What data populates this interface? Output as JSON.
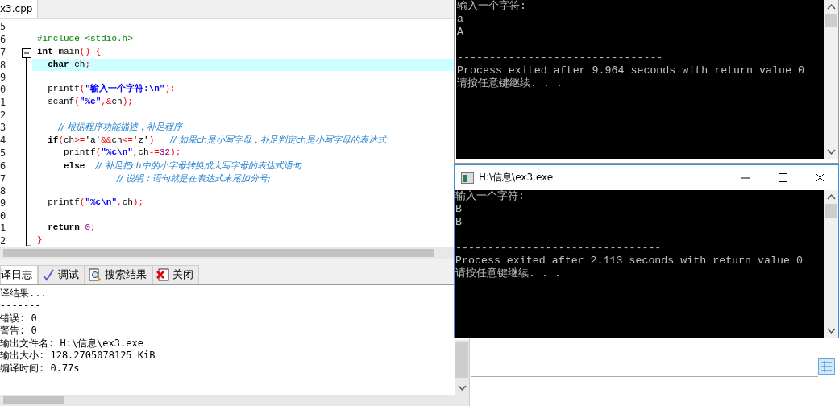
{
  "editor": {
    "tab_label": "x3.cpp",
    "lines": [
      {
        "number": "5",
        "fold_start": false,
        "fold_end": false,
        "current": false
      },
      {
        "number": "6",
        "fold_start": false,
        "fold_end": false,
        "current": false,
        "tokens": [
          {
            "text": "#include <stdio.h>",
            "kind": "preproc"
          }
        ]
      },
      {
        "number": "7",
        "fold_start": true,
        "fold_end": false,
        "current": false,
        "tokens": [
          {
            "text": "int",
            "kind": "keyword"
          },
          {
            "text": " main",
            "kind": "plain"
          },
          {
            "text": "() {",
            "kind": "op"
          }
        ]
      },
      {
        "number": "8",
        "fold_start": false,
        "fold_end": false,
        "current": true,
        "tokens": [
          {
            "text": "  char",
            "kind": "keyword"
          },
          {
            "text": " ch",
            "kind": "plain"
          },
          {
            "text": ";",
            "kind": "op"
          }
        ]
      },
      {
        "number": "9",
        "fold_start": false,
        "fold_end": false,
        "current": false
      },
      {
        "number": "0",
        "fold_start": false,
        "fold_end": false,
        "current": false,
        "tokens": [
          {
            "text": "  printf",
            "kind": "plain"
          },
          {
            "text": "(",
            "kind": "op"
          },
          {
            "text": "\"输入一个字符:\\n\"",
            "kind": "string"
          },
          {
            "text": ");",
            "kind": "op"
          }
        ]
      },
      {
        "number": "1",
        "fold_start": false,
        "fold_end": false,
        "current": false,
        "tokens": [
          {
            "text": "  scanf",
            "kind": "plain"
          },
          {
            "text": "(",
            "kind": "op"
          },
          {
            "text": "\"%c\"",
            "kind": "string"
          },
          {
            "text": ",&",
            "kind": "op"
          },
          {
            "text": "ch",
            "kind": "plain"
          },
          {
            "text": ");",
            "kind": "op"
          }
        ]
      },
      {
        "number": "2",
        "fold_start": false,
        "fold_end": false,
        "current": false
      },
      {
        "number": "3",
        "fold_start": false,
        "fold_end": false,
        "current": false,
        "tokens": [
          {
            "text": "    // 根据程序功能描述，补足程序",
            "kind": "comment"
          }
        ]
      },
      {
        "number": "4",
        "fold_start": false,
        "fold_end": false,
        "current": false,
        "tokens": [
          {
            "text": "  if",
            "kind": "keyword"
          },
          {
            "text": "(",
            "kind": "op"
          },
          {
            "text": "ch",
            "kind": "plain"
          },
          {
            "text": ">=",
            "kind": "op"
          },
          {
            "text": "'a'",
            "kind": "plain"
          },
          {
            "text": "&&",
            "kind": "op"
          },
          {
            "text": "ch",
            "kind": "plain"
          },
          {
            "text": "<=",
            "kind": "op"
          },
          {
            "text": "'z'",
            "kind": "plain"
          },
          {
            "text": ")",
            "kind": "op"
          },
          {
            "text": "   // 如果ch是小写字母，补足判定ch是小写字母的表达式",
            "kind": "comment"
          }
        ]
      },
      {
        "number": "5",
        "fold_start": false,
        "fold_end": false,
        "current": false,
        "tokens": [
          {
            "text": "     printf",
            "kind": "plain"
          },
          {
            "text": "(",
            "kind": "op"
          },
          {
            "text": "\"%c\\n\"",
            "kind": "string"
          },
          {
            "text": ",",
            "kind": "op"
          },
          {
            "text": "ch",
            "kind": "plain"
          },
          {
            "text": "-=",
            "kind": "op"
          },
          {
            "text": "32",
            "kind": "number"
          },
          {
            "text": ");",
            "kind": "op"
          }
        ]
      },
      {
        "number": "6",
        "fold_start": false,
        "fold_end": false,
        "current": false,
        "tokens": [
          {
            "text": "     else",
            "kind": "keyword"
          },
          {
            "text": "  // 补足把ch中的小字母转换成大写字母的表达式语句",
            "kind": "comment"
          }
        ]
      },
      {
        "number": "7",
        "fold_start": false,
        "fold_end": false,
        "current": false,
        "tokens": [
          {
            "text": "               // 说明：语句就是在表达式末尾加分号;",
            "kind": "comment"
          }
        ]
      },
      {
        "number": "8",
        "fold_start": false,
        "fold_end": false,
        "current": false
      },
      {
        "number": "9",
        "fold_start": false,
        "fold_end": false,
        "current": false,
        "tokens": [
          {
            "text": "  printf",
            "kind": "plain"
          },
          {
            "text": "(",
            "kind": "op"
          },
          {
            "text": "\"%c\\n\"",
            "kind": "string"
          },
          {
            "text": ",",
            "kind": "op"
          },
          {
            "text": "ch",
            "kind": "plain"
          },
          {
            "text": ");",
            "kind": "op"
          }
        ]
      },
      {
        "number": "0",
        "fold_start": false,
        "fold_end": false,
        "current": false
      },
      {
        "number": "1",
        "fold_start": false,
        "fold_end": false,
        "current": false,
        "tokens": [
          {
            "text": "  return",
            "kind": "keyword"
          },
          {
            "text": " 0",
            "kind": "number"
          },
          {
            "text": ";",
            "kind": "op"
          }
        ]
      },
      {
        "number": "2",
        "fold_start": false,
        "fold_end": true,
        "current": false,
        "tokens": [
          {
            "text": "}",
            "kind": "op"
          }
        ]
      }
    ]
  },
  "bottom_panel": {
    "tabs": [
      {
        "label": "译日志",
        "selected": true
      },
      {
        "label": "调试",
        "selected": false
      },
      {
        "label": "搜索结果",
        "selected": false
      },
      {
        "label": "关闭",
        "selected": false
      }
    ],
    "log": [
      "译结果...",
      "-------",
      "错误: 0",
      "警告: 0",
      "输出文件名: H:\\信息\\ex3.exe",
      "输出大小: 128.2705078125 KiB",
      "编译时间: 0.77s"
    ]
  },
  "console_1": {
    "lines": [
      {
        "kind": "text",
        "text": "输入一个字符:"
      },
      {
        "kind": "text",
        "text": "a"
      },
      {
        "kind": "text",
        "text": "A"
      },
      {
        "kind": "blank"
      },
      {
        "kind": "text",
        "text": "--------------------------------"
      },
      {
        "kind": "text",
        "text": "Process exited after 9.964 seconds with return value 0"
      },
      {
        "kind": "text",
        "text": "请按任意键继续. . ."
      }
    ]
  },
  "console_2": {
    "title": "H:\\信息\\ex3.exe",
    "lines": [
      {
        "kind": "text",
        "text": "输入一个字符:"
      },
      {
        "kind": "text",
        "text": "B"
      },
      {
        "kind": "text",
        "text": "B"
      },
      {
        "kind": "blank"
      },
      {
        "kind": "text",
        "text": "--------------------------------"
      },
      {
        "kind": "text",
        "text": "Process exited after 2.113 seconds with return value 0"
      },
      {
        "kind": "text",
        "text": "请按任意键继续. . ."
      }
    ]
  }
}
